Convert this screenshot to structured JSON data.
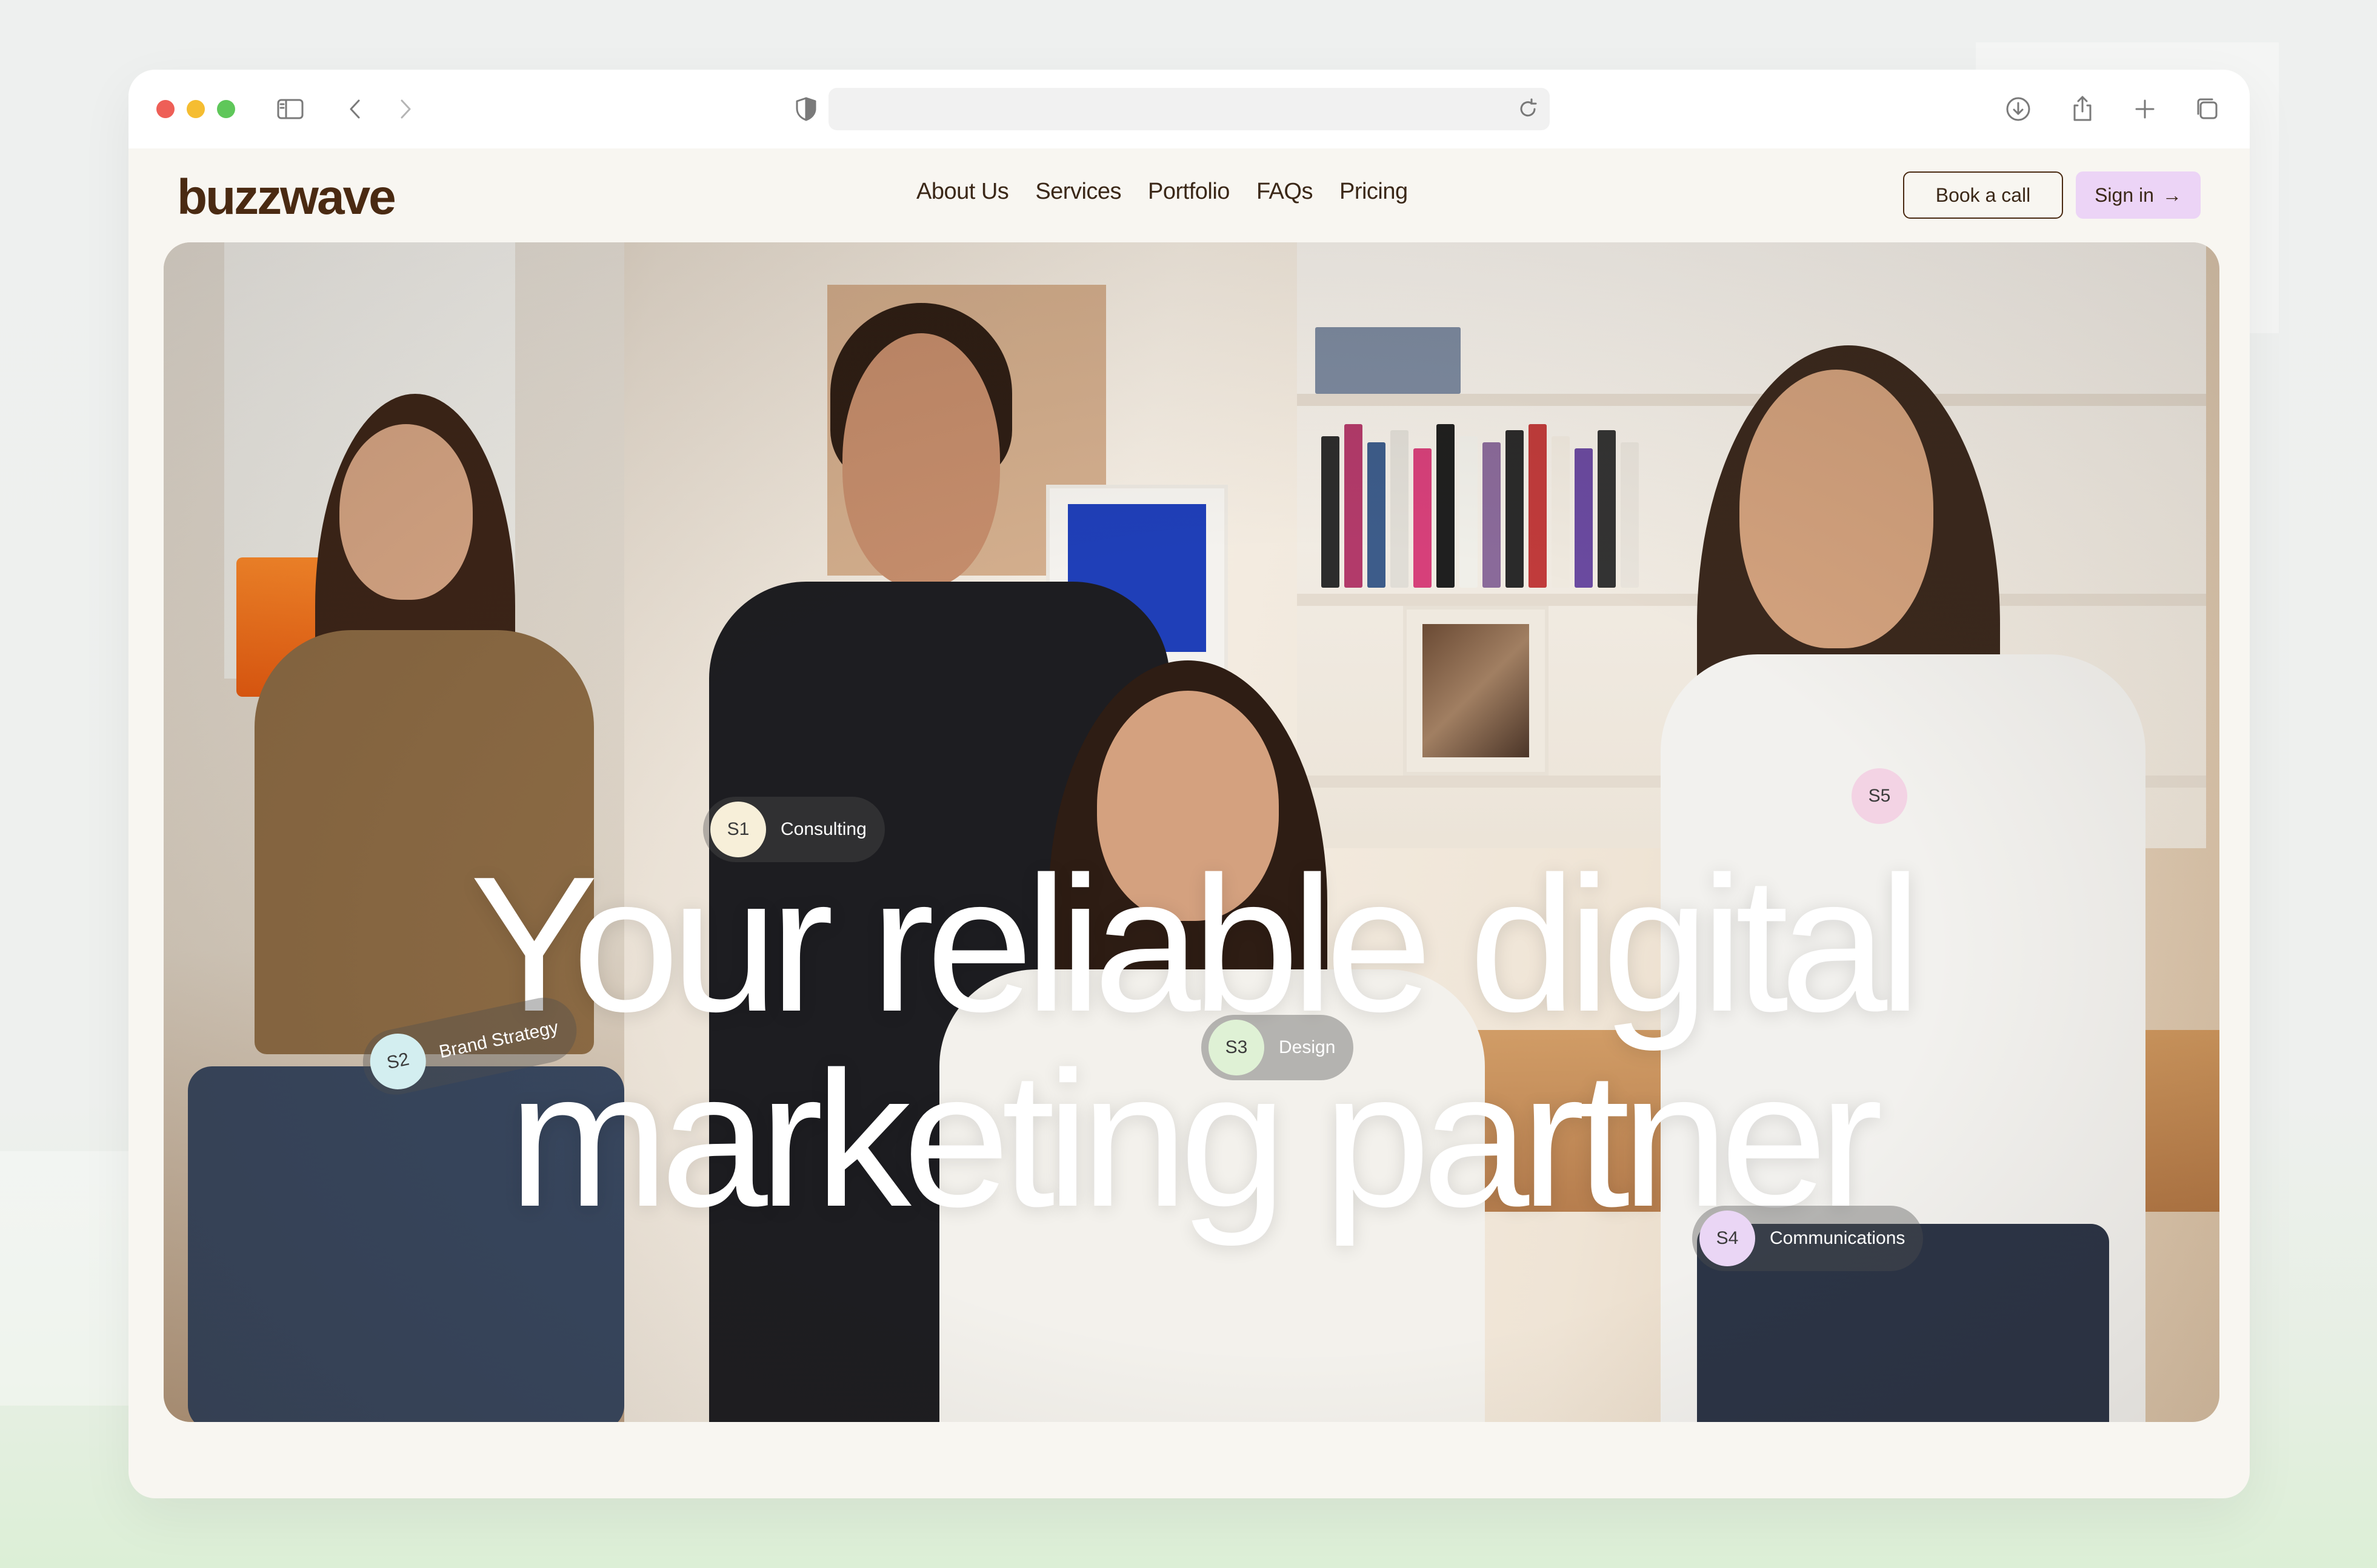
{
  "browser": {
    "address_text": "",
    "icons": [
      "sidebar-icon",
      "back-icon",
      "forward-icon",
      "shield-icon",
      "reload-icon",
      "download-icon",
      "share-icon",
      "new-tab-icon",
      "tabs-overview-icon"
    ]
  },
  "site": {
    "logo": "buzzwave",
    "nav": {
      "about": "About Us",
      "services": "Services",
      "portfolio": "Portfolio",
      "faqs": "FAQs",
      "pricing": "Pricing"
    },
    "book_call": "Book a call",
    "sign_in": "Sign in",
    "sign_in_arrow": "→"
  },
  "hero": {
    "headline_line1": "Your reliable digital",
    "headline_line2": "marketing partner",
    "tags": [
      {
        "badge": "S1",
        "label": "Consulting",
        "color": "#f7efd9"
      },
      {
        "badge": "S2",
        "label": "Brand Strategy",
        "color": "#d3eef0"
      },
      {
        "badge": "S3",
        "label": "Design",
        "color": "#dff1d5"
      },
      {
        "badge": "S4",
        "label": "Communications",
        "color": "#ead6f5"
      },
      {
        "badge": "S5",
        "label": "",
        "color": "#f3d3e4"
      }
    ]
  },
  "colors": {
    "logo": "#4a2a12",
    "sign_in_bg": "#ecd4f6",
    "page_bg": "#f8f6f1"
  }
}
